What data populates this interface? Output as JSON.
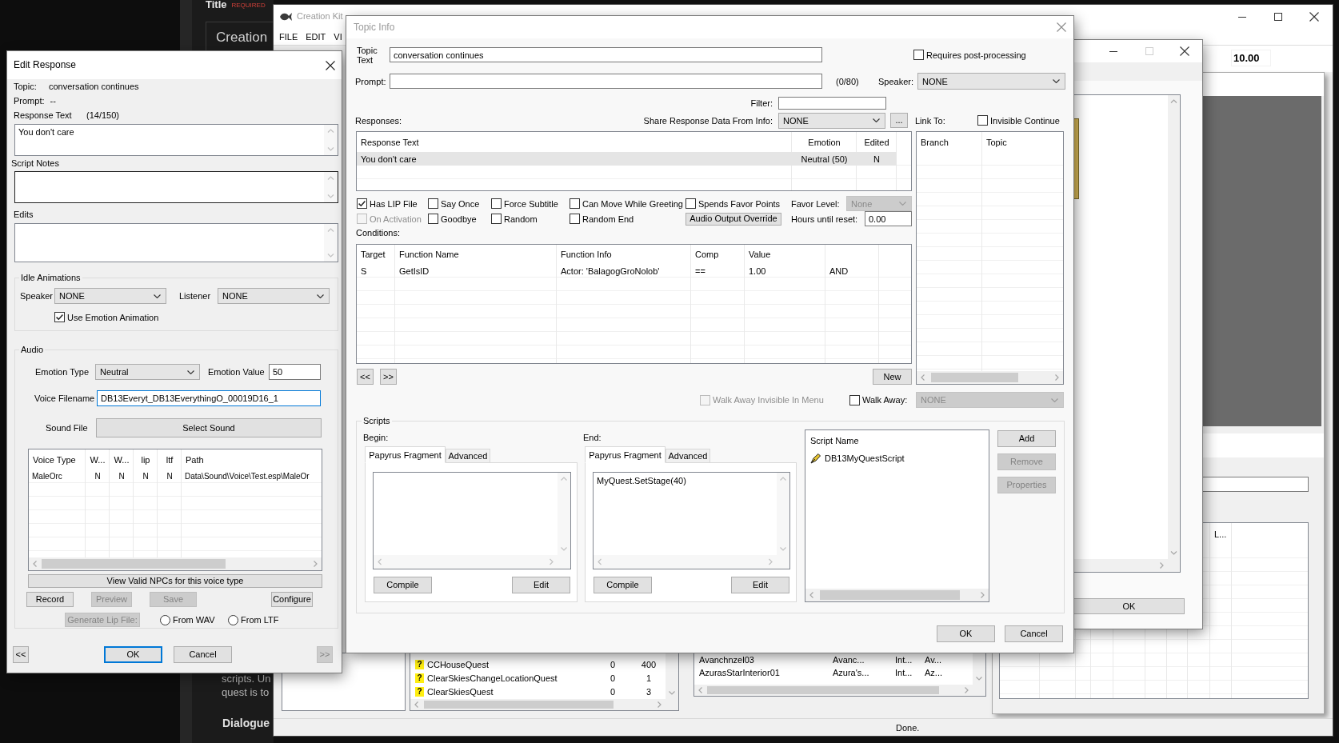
{
  "web_page": {
    "field_label": "Title",
    "required_tag": "REQUIRED",
    "heading": "Creation",
    "body_lines": [
      "scripts. Un",
      "quest is to"
    ],
    "section_title": "Dialogue"
  },
  "main_window": {
    "title": "Creation Kit",
    "menu": [
      "FILE",
      "EDIT",
      "VI"
    ],
    "toolbar_value": "10.00",
    "quest_list": {
      "rows": [
        {
          "marker": "?",
          "name": "CCHouseQuest",
          "column_2": "0",
          "column_3": "400"
        },
        {
          "marker": "?",
          "name": "ClearSkiesChangeLocationQuest",
          "column_2": "0",
          "column_3": "1"
        },
        {
          "marker": "?",
          "name": "ClearSkiesQuest",
          "column_2": "0",
          "column_3": "3"
        }
      ]
    },
    "cell_list": {
      "rows": [
        {
          "name": "Avanchnzel03",
          "column_2": "Avanc...",
          "column_3": "Int...",
          "column_4": "Av..."
        },
        {
          "name": "AzurasStarInterior01",
          "column_2": "Azura's...",
          "column_3": "Int...",
          "column_4": "Az..."
        }
      ]
    },
    "side_table": {
      "header": "L..."
    },
    "status": "Done."
  },
  "edit_response": {
    "title": "Edit Response",
    "topic_label": "Topic:",
    "topic": "conversation continues",
    "prompt_label": "Prompt:",
    "prompt": "--",
    "response_text_label": "Response Text",
    "response_count": "(14/150)",
    "response_text": "You don't care",
    "script_notes_label": "Script Notes",
    "edits_label": "Edits",
    "idle_animations": {
      "title": "Idle Animations",
      "speaker_label": "Speaker",
      "speaker": "NONE",
      "listener_label": "Listener",
      "listener": "NONE",
      "use_emotion_animation": {
        "label": "Use Emotion Animation",
        "checked": true
      }
    },
    "audio": {
      "title": "Audio",
      "emotion_type_label": "Emotion Type",
      "emotion_type": "Neutral",
      "emotion_value_label": "Emotion Value",
      "emotion_value": "50",
      "voice_filename_label": "Voice Filename",
      "voice_filename": {
        "value": "DB13Everyt_DB13EverythingO_00019D16_1",
        "focused": true
      },
      "sound_file_label": "Sound File",
      "select_sound_button": "Select Sound",
      "voice_table": {
        "columns": [
          "Voice Type",
          "W...",
          "W...",
          "lip",
          "ltf",
          "Path"
        ],
        "rows": [
          [
            "MaleOrc",
            "N",
            "N",
            "N",
            "N",
            "Data\\Sound\\Voice\\Test.esp\\MaleOr"
          ]
        ]
      },
      "view_npcs_button": "View Valid NPCs for this voice type",
      "buttons": [
        {
          "label": "Record",
          "disabled": false
        },
        {
          "label": "Preview",
          "disabled": true
        },
        {
          "label": "Save",
          "disabled": true
        },
        {
          "label": "Configure",
          "disabled": false
        }
      ],
      "generate_lip_button": {
        "label": "Generate Lip File:",
        "disabled": true
      },
      "lip_sources": [
        {
          "label": "From WAV",
          "selected": false
        },
        {
          "label": "From LTF",
          "selected": false
        }
      ]
    },
    "prev_button": {
      "label": "<<",
      "disabled": false
    },
    "next_button": {
      "label": ">>",
      "disabled": true
    },
    "ok_button": "OK",
    "cancel_button": "Cancel"
  },
  "back_dialog": {
    "ok_button": "OK"
  },
  "topic_info": {
    "title": "Topic Info",
    "topic_text_label": "Topic Text",
    "topic_text": "conversation continues",
    "requires_post_processing": {
      "label": "Requires post-processing",
      "checked": false
    },
    "prompt_label": "Prompt:",
    "prompt_count": "(0/80)",
    "speaker_label": "Speaker:",
    "speaker": "NONE",
    "filter_label": "Filter:",
    "responses_label": "Responses:",
    "share_label": "Share Response Data From Info:",
    "share_value": "NONE",
    "more_button": "...",
    "link_to_label": "Link To:",
    "invisible_continue": {
      "label": "Invisible Continue",
      "checked": false
    },
    "responses_table": {
      "columns": [
        "Response Text",
        "Emotion",
        "Edited"
      ],
      "rows": [
        {
          "cells": [
            "You don't care",
            "Neutral (50)",
            "N"
          ],
          "selected": true
        }
      ]
    },
    "link_table": {
      "columns": [
        "Branch",
        "Topic"
      ]
    },
    "flags": [
      {
        "label": "Has LIP File",
        "checked": true,
        "disabled": false
      },
      {
        "label": "Say Once",
        "checked": false,
        "disabled": false
      },
      {
        "label": "Force Subtitle",
        "checked": false,
        "disabled": false
      },
      {
        "label": "Can Move While Greeting",
        "checked": false,
        "disabled": false
      },
      {
        "label": "Spends Favor Points",
        "checked": false,
        "disabled": false
      },
      {
        "label": "On Activation",
        "checked": false,
        "disabled": true
      },
      {
        "label": "Goodbye",
        "checked": false,
        "disabled": false
      },
      {
        "label": "Random",
        "checked": false,
        "disabled": false
      },
      {
        "label": "Random End",
        "checked": false,
        "disabled": false
      }
    ],
    "audio_output_override_button": "Audio Output Override",
    "favor_level": {
      "label": "Favor Level:",
      "value": "None",
      "disabled": true
    },
    "hours_until_reset": {
      "label": "Hours until reset:",
      "value": "0.00"
    },
    "conditions_label": "Conditions:",
    "conditions_table": {
      "columns": [
        "Target",
        "Function Name",
        "Function Info",
        "Comp",
        "Value"
      ],
      "rows": [
        [
          "S",
          "GetIsID",
          "Actor: 'BalagogGroNolob'",
          "==",
          "1.00",
          "AND"
        ]
      ]
    },
    "prev_button": "<<",
    "next_button": ">>",
    "new_button": "New",
    "walk_away_invisible": {
      "label": "Walk Away Invisible In Menu",
      "checked": false,
      "disabled": true
    },
    "walk_away": {
      "label": "Walk Away:",
      "checked": false
    },
    "walk_away_topic": {
      "value": "NONE",
      "disabled": true
    },
    "scripts": {
      "title": "Scripts",
      "fragments": [
        {
          "label": "Begin:",
          "tabs": [
            {
              "label": "Papyrus Fragment",
              "selected": true
            },
            {
              "label": "Advanced",
              "selected": false
            }
          ],
          "compile_button": "Compile",
          "edit_button": "Edit"
        },
        {
          "label": "End:",
          "tabs": [
            {
              "label": "Papyrus Fragment",
              "selected": true
            },
            {
              "label": "Advanced",
              "selected": false
            }
          ],
          "code": "MyQuest.SetStage(40)",
          "compile_button": "Compile",
          "edit_button": "Edit"
        }
      ],
      "script_list": {
        "column": "Script Name",
        "rows": [
          "DB13MyQuestScript"
        ]
      },
      "buttons": [
        {
          "label": "Add",
          "disabled": false
        },
        {
          "label": "Remove",
          "disabled": true
        },
        {
          "label": "Properties",
          "disabled": true
        }
      ]
    },
    "ok_button": "OK",
    "cancel_button": "Cancel"
  }
}
